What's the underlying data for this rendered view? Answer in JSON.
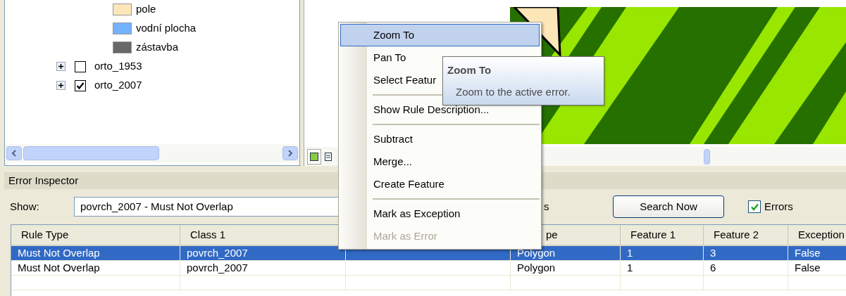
{
  "toc": {
    "legend": [
      {
        "label": "pole",
        "color": "#fde6b8"
      },
      {
        "label": "vodní plocha",
        "color": "#73b2ff"
      },
      {
        "label": "zástavba",
        "color": "#686868"
      }
    ],
    "layers": [
      {
        "label": "orto_1953",
        "checked": false,
        "expanded": false
      },
      {
        "label": "orto_2007",
        "checked": true,
        "expanded": false
      }
    ]
  },
  "error_inspector": {
    "title": "Error Inspector",
    "show_label": "Show:",
    "show_value": "povrch_2007 - Must Not Overlap",
    "partial_label": "s",
    "search_button": "Search Now",
    "errors_checkbox": {
      "label": "Errors",
      "checked": true
    },
    "table": {
      "columns": [
        "Rule Type",
        "Class 1",
        "",
        "pe",
        "Feature 1",
        "Feature 2",
        "Exception"
      ],
      "rows": [
        {
          "selected": true,
          "cells": [
            "Must Not Overlap",
            "povrch_2007",
            "",
            "Polygon",
            "1",
            "3",
            "False"
          ]
        },
        {
          "selected": false,
          "cells": [
            "Must Not Overlap",
            "povrch_2007",
            "",
            "Polygon",
            "1",
            "6",
            "False"
          ]
        }
      ]
    }
  },
  "context_menu": {
    "items": [
      {
        "kind": "item",
        "label": "Zoom To",
        "selected": true,
        "disabled": false
      },
      {
        "kind": "item",
        "label": "Pan To",
        "selected": false,
        "disabled": false
      },
      {
        "kind": "item",
        "label": "Select Featur",
        "selected": false,
        "disabled": false
      },
      {
        "kind": "separator"
      },
      {
        "kind": "item",
        "label": "Show Rule Description...",
        "selected": false,
        "disabled": false
      },
      {
        "kind": "separator"
      },
      {
        "kind": "item",
        "label": "Subtract",
        "selected": false,
        "disabled": false
      },
      {
        "kind": "item",
        "label": "Merge...",
        "selected": false,
        "disabled": false
      },
      {
        "kind": "item",
        "label": "Create Feature",
        "selected": false,
        "disabled": false
      },
      {
        "kind": "separator"
      },
      {
        "kind": "item",
        "label": "Mark as Exception",
        "selected": false,
        "disabled": false
      },
      {
        "kind": "item",
        "label": "Mark as Error",
        "selected": false,
        "disabled": true
      }
    ]
  },
  "tooltip": {
    "title": "Zoom To",
    "text": "Zoom to the active error."
  }
}
